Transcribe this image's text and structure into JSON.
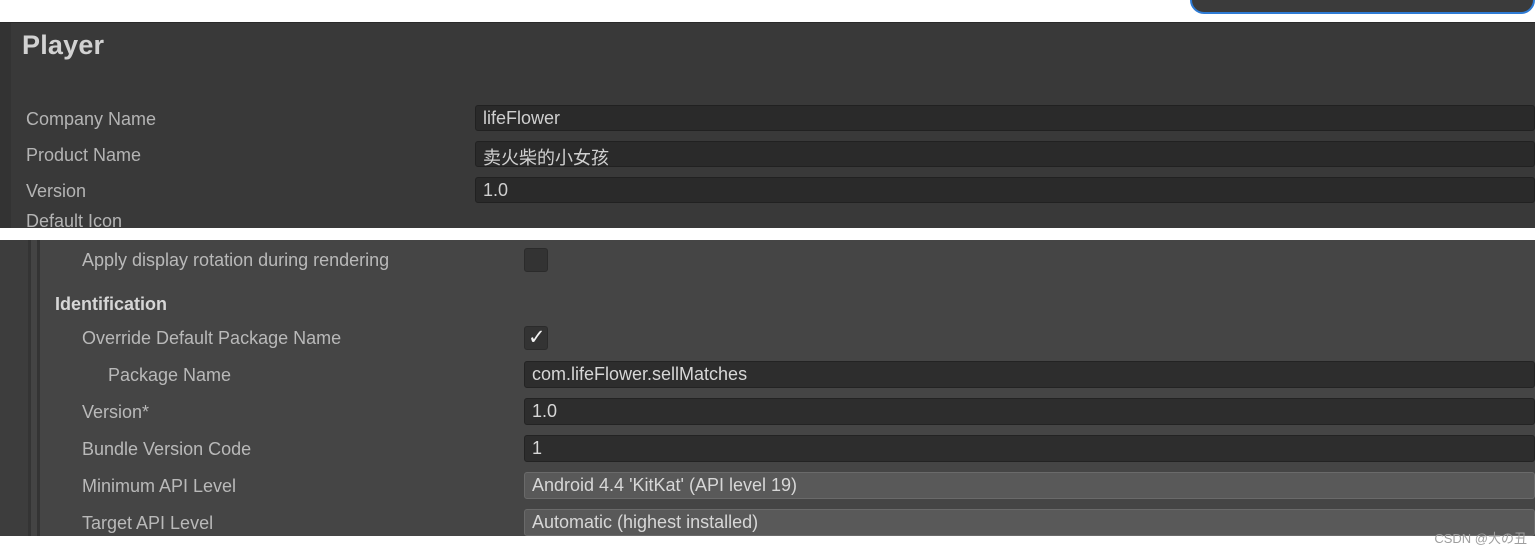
{
  "search": {
    "placeholder": ""
  },
  "player_panel": {
    "title": "Player",
    "rows": [
      {
        "label": "Company Name",
        "value": "lifeFlower"
      },
      {
        "label": "Product Name",
        "value": "卖火柴的小女孩"
      },
      {
        "label": "Version",
        "value": "1.0"
      }
    ],
    "clipped_row_label": "Default Icon"
  },
  "android_panel": {
    "rows": [
      {
        "label": "Apply display rotation during rendering",
        "type": "checkbox",
        "indent": 2,
        "checked": false
      },
      {
        "label": "Identification",
        "type": "header",
        "indent": 1
      },
      {
        "label": "Override Default Package Name",
        "type": "checkbox",
        "indent": 2,
        "checked": true
      },
      {
        "label": "Package Name",
        "type": "input",
        "indent": 3,
        "value": "com.lifeFlower.sellMatches"
      },
      {
        "label": "Version*",
        "type": "input",
        "indent": 2,
        "value": "1.0"
      },
      {
        "label": "Bundle Version Code",
        "type": "input",
        "indent": 2,
        "value": "1"
      },
      {
        "label": "Minimum API Level",
        "type": "dropdown",
        "indent": 2,
        "value": "Android 4.4 'KitKat' (API level 19)"
      },
      {
        "label": "Target API Level",
        "type": "dropdown",
        "indent": 2,
        "value": "Automatic (highest installed)"
      }
    ]
  },
  "watermark": {
    "text": "CSDN @大の丑"
  },
  "colors": {
    "panel_one_bg": "#393939",
    "panel_two_bg": "#454545",
    "input_bg": "#2d2d2d",
    "dropdown_bg": "#595959",
    "accent_blue": "#2e7bd4",
    "label_text": "#b9b9b9",
    "value_text": "#d7d7d7"
  }
}
